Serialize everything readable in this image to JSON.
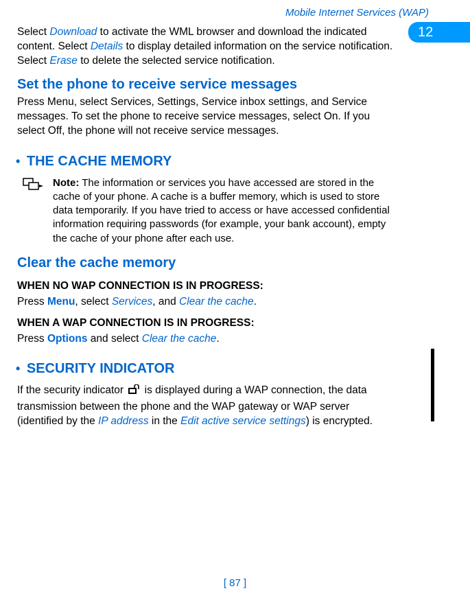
{
  "header": {
    "title": "Mobile Internet Services (WAP)"
  },
  "chapter": {
    "number": "12"
  },
  "intro": {
    "t1": "Select ",
    "download": "Download",
    "t2": " to activate the WML browser and download the indicated content. Select ",
    "details": "Details",
    "t3": " to display detailed information on the service notification. Select ",
    "erase": "Erase",
    "t4": " to delete the selected service notification."
  },
  "set_phone": {
    "heading": "Set the phone to receive service messages",
    "body": "Press Menu, select Services, Settings, Service inbox settings, and Service messages. To set the phone to receive service messages, select On. If you select Off, the phone will not receive service messages."
  },
  "cache": {
    "heading": " THE CACHE MEMORY",
    "note_label": "Note:",
    "note_body": " The information or services you have accessed are stored in the cache of your phone. A cache is a buffer memory, which is used to store data temporarily. If you have tried to access or have accessed confidential information requiring passwords (for example, your bank account), empty the cache of your phone after each use."
  },
  "clear": {
    "heading": "Clear the cache memory",
    "no_conn_title": "WHEN NO WAP CONNECTION IS IN PROGRESS:",
    "no_conn": {
      "t1": "Press ",
      "menu": "Menu",
      "t2": ", select ",
      "services": "Services",
      "t3": ", and ",
      "clear": "Clear the cache",
      "t4": "."
    },
    "conn_title": "WHEN A WAP CONNECTION IS IN PROGRESS:",
    "conn": {
      "t1": "Press ",
      "options": "Options",
      "t2": " and select ",
      "clear": "Clear the cache",
      "t3": "."
    }
  },
  "security": {
    "heading": " SECURITY INDICATOR",
    "t1": "If the security indicator ",
    "t2": " is displayed during a WAP connection, the data transmission between the phone and the WAP gateway or WAP server (identified by the ",
    "ip": "IP address",
    "t3": " in the ",
    "edit": "Edit active service settings",
    "t4": ") is encrypted."
  },
  "footer": {
    "page": "[ 87 ]"
  }
}
